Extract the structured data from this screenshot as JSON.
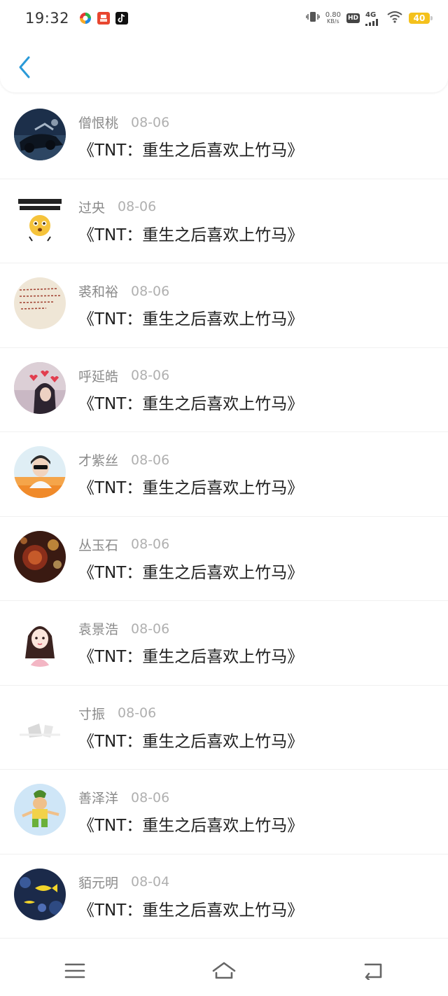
{
  "status_bar": {
    "time": "19:32",
    "speed_value": "0.80",
    "speed_unit": "KB/s",
    "hd": "HD",
    "network": "4G",
    "battery": "40",
    "apps": [
      "360-browser-icon",
      "red-app-icon",
      "tiktok-icon"
    ]
  },
  "header": {
    "back_icon": "chevron-left-icon",
    "accent_color": "#2a9ad8"
  },
  "messages": [
    {
      "name": "僧恨桃",
      "date": "08-06",
      "text": "《TNT：重生之后喜欢上竹马》",
      "avatar": "dark-car-photo"
    },
    {
      "name": "过央",
      "date": "08-06",
      "text": "《TNT：重生之后喜欢上竹马》",
      "avatar": "emoji-meme"
    },
    {
      "name": "裘和裕",
      "date": "08-06",
      "text": "《TNT：重生之后喜欢上竹马》",
      "avatar": "handwritten-note"
    },
    {
      "name": "呼延皓",
      "date": "08-06",
      "text": "《TNT：重生之后喜欢上竹马》",
      "avatar": "girl-with-hearts"
    },
    {
      "name": "才紫丝",
      "date": "08-06",
      "text": "《TNT：重生之后喜欢上竹马》",
      "avatar": "boy-sunglasses"
    },
    {
      "name": "丛玉石",
      "date": "08-06",
      "text": "《TNT：重生之后喜欢上竹马》",
      "avatar": "lantern-bokeh"
    },
    {
      "name": "袁景浩",
      "date": "08-06",
      "text": "《TNT：重生之后喜欢上竹马》",
      "avatar": "anime-girl"
    },
    {
      "name": "寸振",
      "date": "08-06",
      "text": "《TNT：重生之后喜欢上竹马》",
      "avatar": "white-abstract"
    },
    {
      "name": "善泽洋",
      "date": "08-06",
      "text": "《TNT：重生之后喜欢上竹马》",
      "avatar": "cartoon-calabash-boy"
    },
    {
      "name": "貊元明",
      "date": "08-04",
      "text": "《TNT：重生之后喜欢上竹马》",
      "avatar": "aquarium-fish"
    }
  ],
  "nav_bar": {
    "menu_icon": "menu-icon",
    "home_icon": "home-icon",
    "back_icon": "back-icon"
  }
}
